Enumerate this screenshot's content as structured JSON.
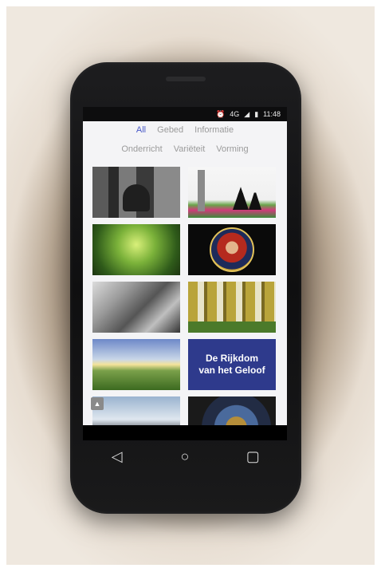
{
  "status_bar": {
    "network": "4G",
    "time": "11:48",
    "icons": [
      "alarm-icon",
      "signal-icon",
      "battery-icon"
    ]
  },
  "tabs_row1": [
    "All",
    "Gebed",
    "Informatie"
  ],
  "tabs_row2": [
    "Onderricht",
    "Variëteit",
    "Vorming"
  ],
  "active_tab": "All",
  "grid_tiles": [
    {
      "name": "bell-tower-photo"
    },
    {
      "name": "procession-silhouette-photo"
    },
    {
      "name": "tree-canopy-photo"
    },
    {
      "name": "christ-medallion-painting"
    },
    {
      "name": "classroom-photo"
    },
    {
      "name": "mosaic-saints-photo"
    },
    {
      "name": "sunset-field-photo"
    },
    {
      "name": "promo-card",
      "line1": "De Rijkdom",
      "line2": "van het Geloof"
    },
    {
      "name": "sky-photo"
    },
    {
      "name": "astronomical-clock-photo"
    }
  ],
  "scroll_top_icon": "chevron-up-icon",
  "nav_icons": [
    "back-triangle-icon",
    "home-circle-icon",
    "recents-square-icon"
  ],
  "colors": {
    "accent_active_tab": "#4a5ac8",
    "promo_card_bg": "#2e3a8c",
    "inactive_tab": "#9b9b9b"
  }
}
